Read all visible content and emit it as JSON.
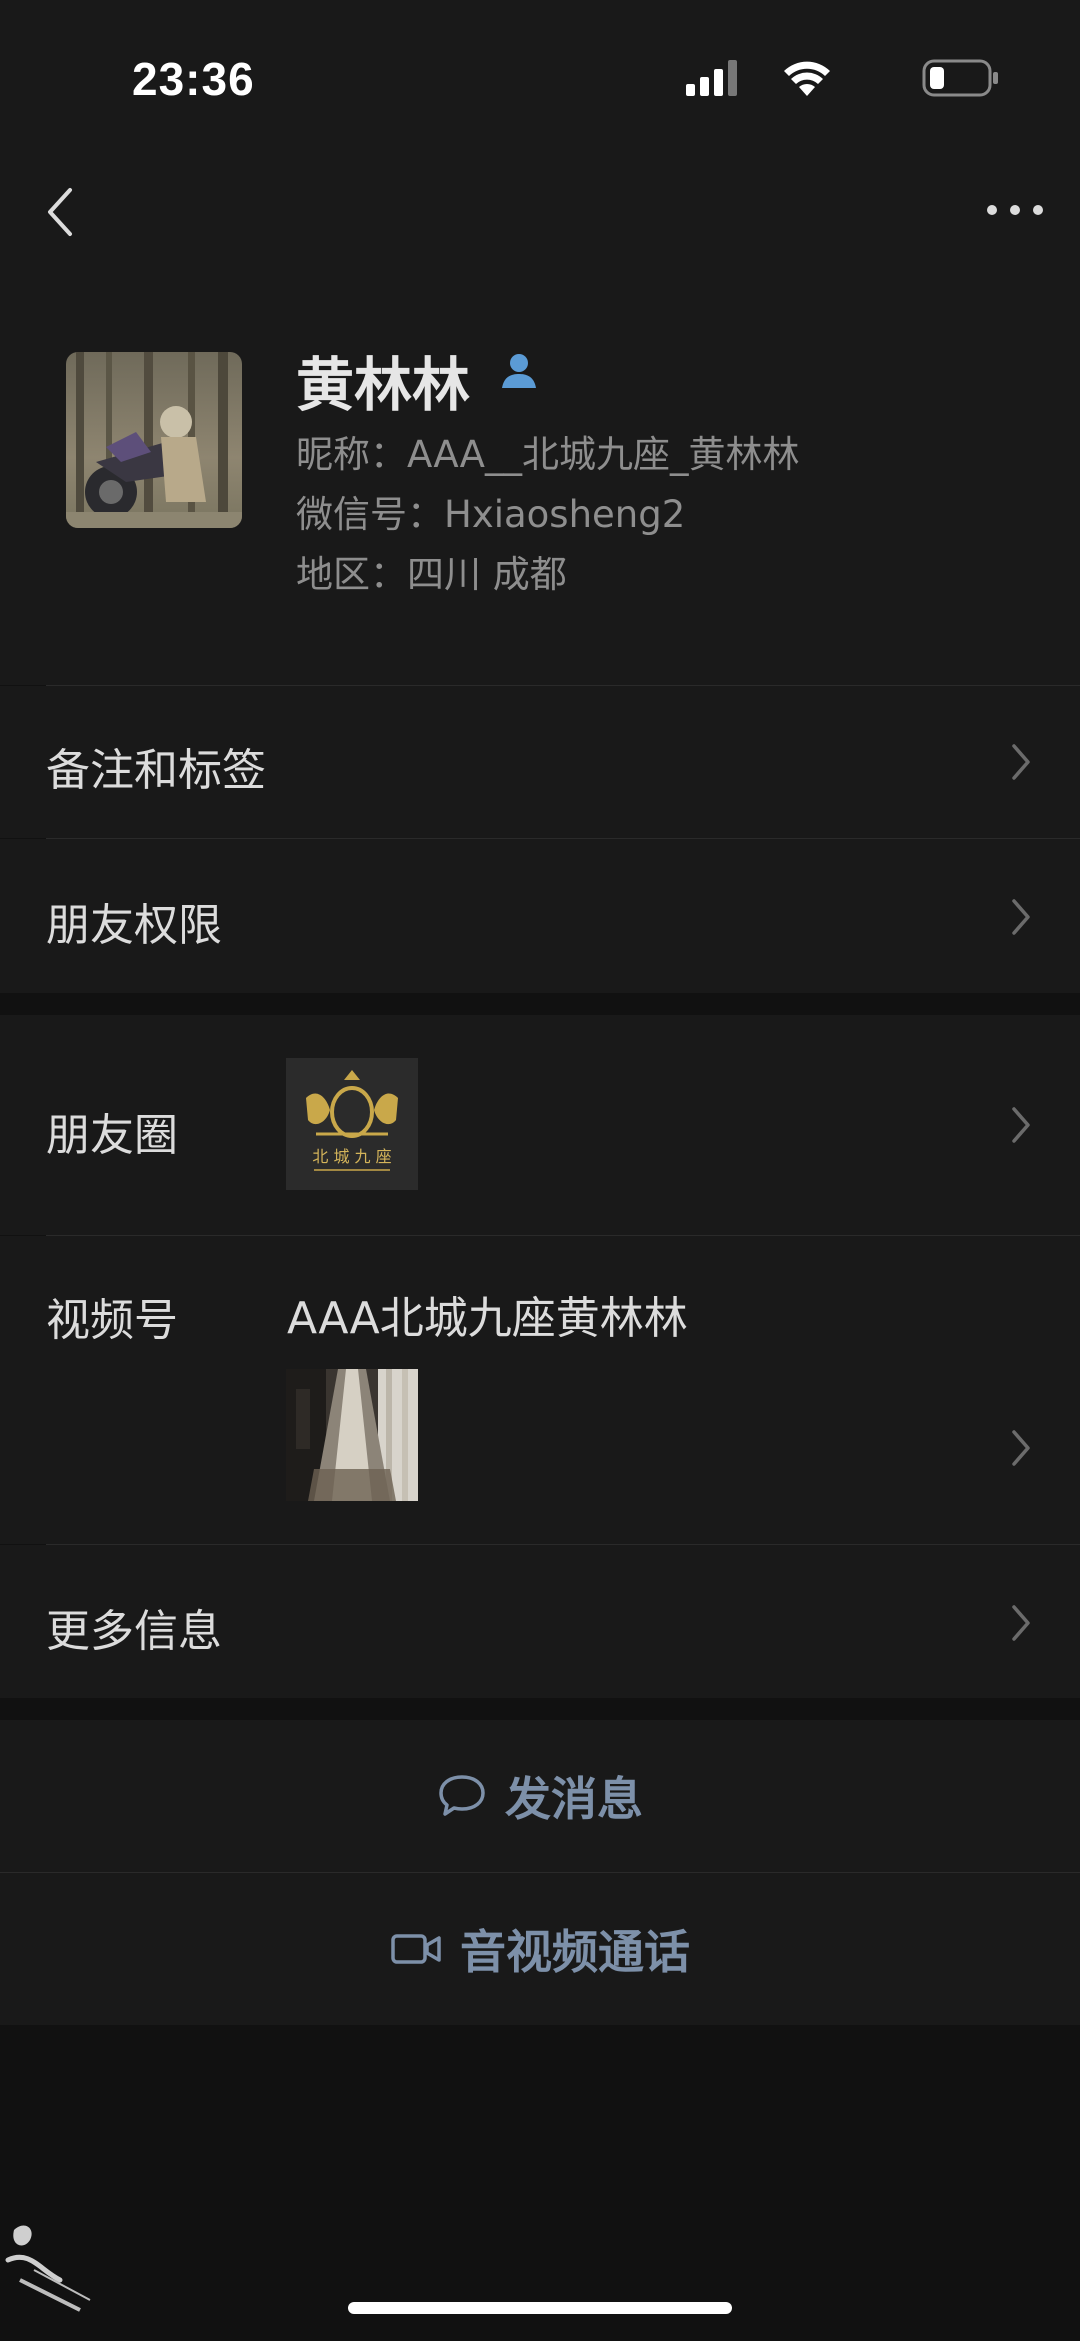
{
  "status_bar": {
    "time": "23:36",
    "icons": [
      "signal-icon",
      "wifi-icon",
      "battery-icon"
    ]
  },
  "nav": {
    "back_icon": "chevron-left-icon",
    "more_icon": "more-dots-icon"
  },
  "profile": {
    "name": "黄林林",
    "nickname": "昵称：AAA__北城九座_黄林林",
    "wechat_id": "微信号：Hxiaosheng2",
    "region": "地区：四川 成都"
  },
  "rows": {
    "remarks": "备注和标签",
    "permissions": "朋友权限",
    "moments": "朋友圈",
    "moments_thumb_text": "北 城 九 座",
    "channels": "视频号",
    "channels_name": "AAA北城九座黄林林",
    "more_info": "更多信息"
  },
  "actions": {
    "message": "发消息",
    "call": "音视频通话"
  },
  "colors": {
    "background": "#111111",
    "surface": "#191919",
    "action_text": "#7d90a9",
    "person_icon": "#5b9bd5"
  }
}
